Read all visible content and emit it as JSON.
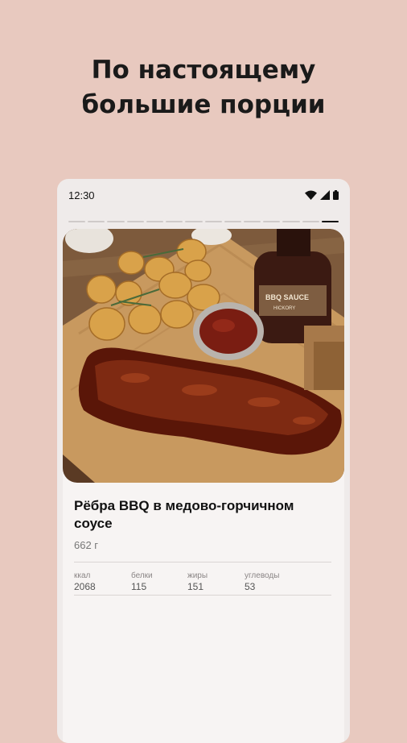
{
  "headline": {
    "line1": "По настоящему",
    "line2": "большие порции"
  },
  "status_bar": {
    "time": "12:30",
    "icons": [
      "wifi-icon",
      "signal-icon",
      "battery-icon"
    ]
  },
  "story_progress": {
    "total": 14,
    "active_index": 13
  },
  "dish": {
    "title": "Рёбра BBQ в медово-горчичном соусе",
    "weight": "662 г",
    "sauce_label": "BBQ SAUCE",
    "sauce_sublabel": "HICKORY",
    "nutrition": [
      {
        "label": "ккал",
        "value": "2068"
      },
      {
        "label": "белки",
        "value": "115"
      },
      {
        "label": "жиры",
        "value": "151"
      },
      {
        "label": "углеводы",
        "value": "53"
      }
    ]
  },
  "colors": {
    "background": "#e8c9bf",
    "phone": "#efebea",
    "text": "#111111",
    "muted": "#8a8585"
  }
}
